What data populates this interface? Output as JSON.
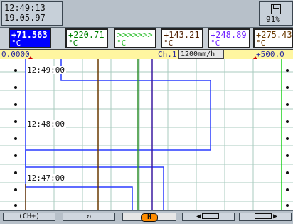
{
  "header": {
    "time": "12:49:13",
    "date": "19.05.97",
    "disk_percent": "91%"
  },
  "channels": [
    {
      "value": "+71.563",
      "unit": "°C",
      "color": "#0000ff",
      "selected": true
    },
    {
      "value": "+220.71",
      "unit": "°C",
      "color": "#008000"
    },
    {
      "value": ">>>>>>>",
      "unit": "°C",
      "color": "#30c030"
    },
    {
      "value": "+143.21",
      "unit": "°C",
      "color": "#502000"
    },
    {
      "value": "+248.89",
      "unit": "°C",
      "color": "#7020ff"
    },
    {
      "value": "+275.43",
      "unit": "°C",
      "color": "#6a3a00"
    }
  ],
  "scale": {
    "left": "0.0000",
    "channel": "Ch.1",
    "speed": "1200mm/h",
    "right": "+500.0"
  },
  "chart": {
    "time_labels": [
      "12:49:00",
      "12:48:00",
      "12:47:00"
    ],
    "colors": {
      "grid": "#a9cbbf",
      "blue": "#2a3cff",
      "brown": "#5a2a00",
      "green": "#2f8f2f",
      "purple": "#3c1aa0"
    }
  },
  "buttons": {
    "ch_plus": "(CH+)",
    "refresh": "↻",
    "hold": "H",
    "scroll_left": "",
    "scroll_right": ""
  }
}
